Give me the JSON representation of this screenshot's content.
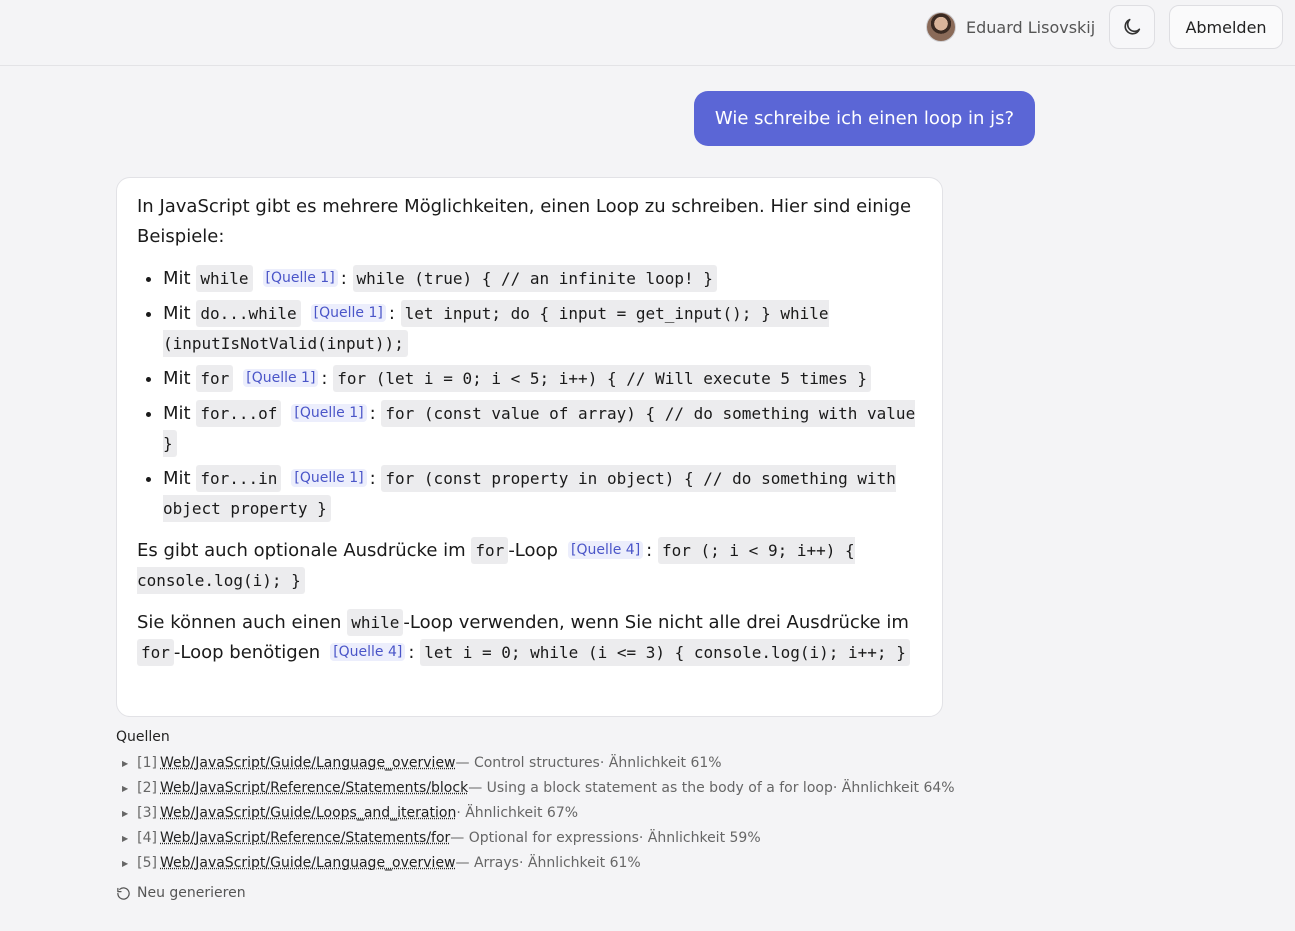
{
  "header": {
    "user_name": "Eduard Lisovskij",
    "logout_label": "Abmelden"
  },
  "user_message": "Wie schreibe ich einen loop in js?",
  "answer": {
    "intro": "In JavaScript gibt es mehrere Möglichkeiten, einen Loop zu schreiben. Hier sind einige Beispiele:",
    "items": [
      {
        "prefix": "Mit",
        "keyword": "while",
        "cite": "[Quelle 1]",
        "code": "while (true) { // an infinite loop! }"
      },
      {
        "prefix": "Mit",
        "keyword": "do...while",
        "cite": "[Quelle 1]",
        "code": "let input; do { input = get_input(); } while (inputIsNotValid(input));"
      },
      {
        "prefix": "Mit",
        "keyword": "for",
        "cite": "[Quelle 1]",
        "code": "for (let i = 0; i < 5; i++) { // Will execute 5 times }"
      },
      {
        "prefix": "Mit",
        "keyword": "for...of",
        "cite": "[Quelle 1]",
        "code": "for (const value of array) { // do something with value }"
      },
      {
        "prefix": "Mit",
        "keyword": "for...in",
        "cite": "[Quelle 1]",
        "code": "for (const property in object) { // do something with object property }"
      }
    ],
    "para2": {
      "text1": "Es gibt auch optionale Ausdrücke im",
      "keyword": "for",
      "text2": "-Loop",
      "cite": "[Quelle 4]",
      "code": "for (; i < 9; i++) { console.log(i); }"
    },
    "para3": {
      "text1": "Sie können auch einen",
      "keyword1": "while",
      "text2": "-Loop verwenden, wenn Sie nicht alle drei Ausdrücke im",
      "keyword2": "for",
      "text3": "-Loop benötigen",
      "cite": "[Quelle 4]",
      "code": "let i = 0; while (i <= 3) { console.log(i); i++; }"
    },
    "colon": ":"
  },
  "sources": {
    "title": "Quellen",
    "items": [
      {
        "num": "[1]",
        "path": "Web/JavaScript/Guide/Language_overview",
        "desc": " — Control structures",
        "sim": " · Ähnlichkeit 61%"
      },
      {
        "num": "[2]",
        "path": "Web/JavaScript/Reference/Statements/block",
        "desc": " — Using a block statement as the body of a for loop",
        "sim": " · Ähnlichkeit 64%"
      },
      {
        "num": "[3]",
        "path": "Web/JavaScript/Guide/Loops_and_iteration",
        "desc": "",
        "sim": " · Ähnlichkeit 67%"
      },
      {
        "num": "[4]",
        "path": "Web/JavaScript/Reference/Statements/for",
        "desc": " — Optional for expressions",
        "sim": " · Ähnlichkeit 59%"
      },
      {
        "num": "[5]",
        "path": "Web/JavaScript/Guide/Language_overview",
        "desc": " — Arrays",
        "sim": " · Ähnlichkeit 61%"
      }
    ]
  },
  "regenerate_label": "Neu generieren"
}
